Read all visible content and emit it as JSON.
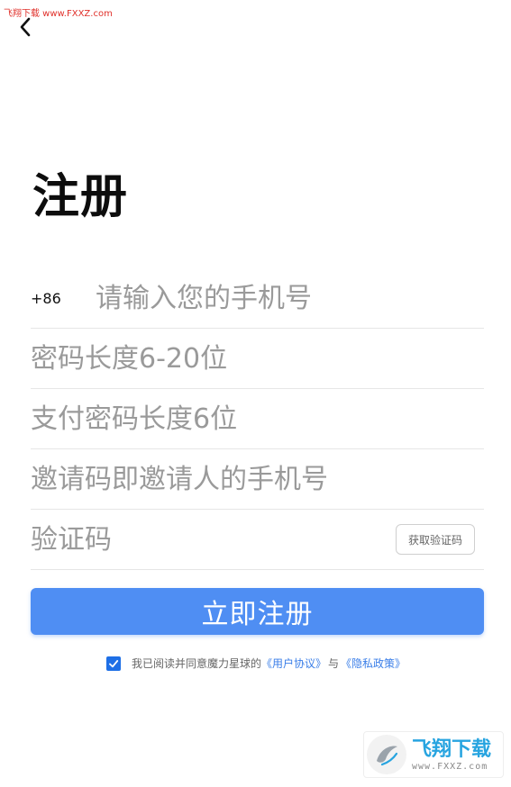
{
  "watermark": {
    "top_text": "飞翔下载 www.FXXZ.com",
    "bottom_title": "飞翔下载",
    "bottom_url": "www.FXXZ.com"
  },
  "header": {
    "back_icon": "chevron-left-icon"
  },
  "page": {
    "title": "注册"
  },
  "form": {
    "phone": {
      "country_code": "+86",
      "placeholder": "请输入您的手机号",
      "value": ""
    },
    "password": {
      "placeholder": "密码长度6-20位",
      "value": ""
    },
    "pay_password": {
      "placeholder": "支付密码长度6位",
      "value": ""
    },
    "invite_code": {
      "placeholder": "邀请码即邀请人的手机号",
      "value": ""
    },
    "verify_code": {
      "placeholder": "验证码",
      "value": "",
      "get_code_label": "获取验证码"
    }
  },
  "submit": {
    "label": "立即注册"
  },
  "agreement": {
    "checked": true,
    "prefix": "我已阅读并同意魔力星球的",
    "user_agreement": "《用户协议》",
    "conjunction": "与",
    "privacy_policy": "《隐私政策》"
  },
  "colors": {
    "primary": "#4f8ef3",
    "link": "#3a7ee8",
    "checkbox": "#1e6fe6",
    "watermark_red": "#e0302a"
  }
}
